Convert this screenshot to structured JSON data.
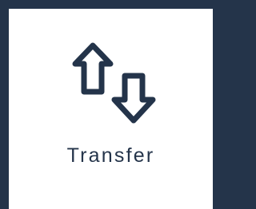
{
  "tile": {
    "label": "Transfer",
    "icon": "transfer-arrows-icon"
  },
  "colors": {
    "frame": "#24344a",
    "card": "#ffffff",
    "icon_stroke": "#24344a",
    "label": "#24344a"
  }
}
